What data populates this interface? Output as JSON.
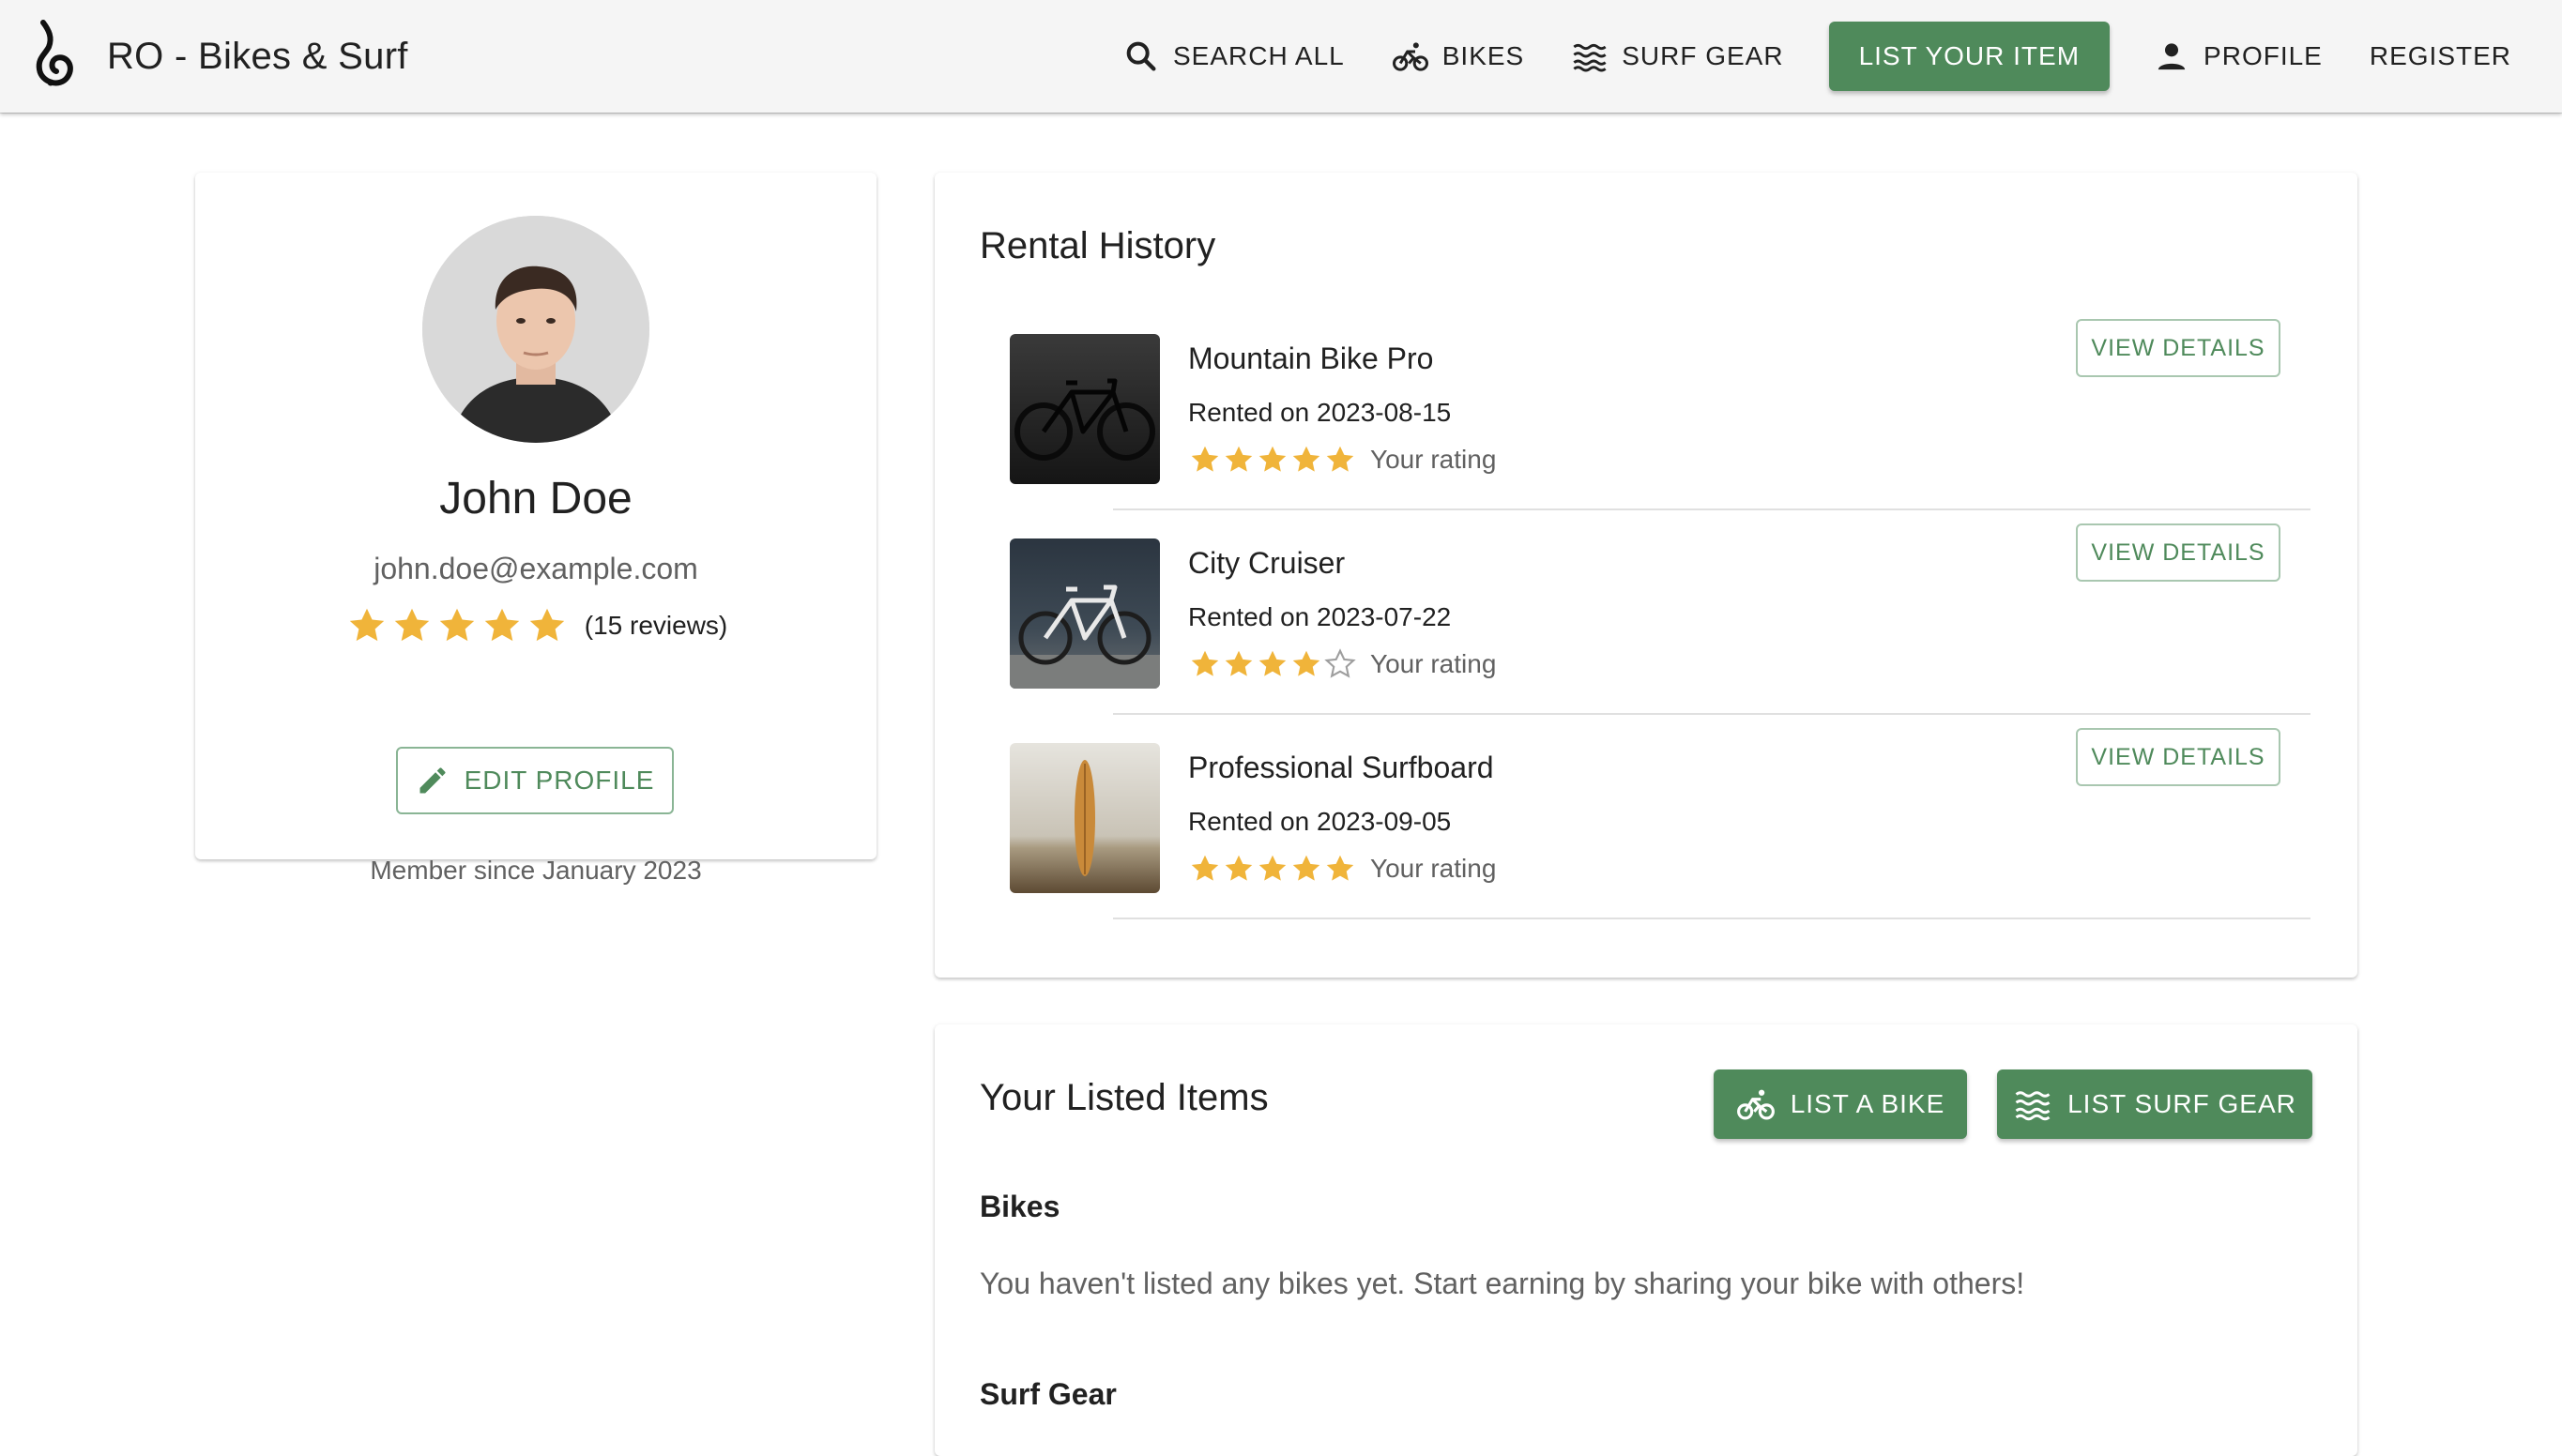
{
  "app": {
    "title": "RO - Bikes & Surf",
    "logo_icon": "logo-hook-icon"
  },
  "nav": {
    "items": [
      {
        "label": "SEARCH ALL",
        "icon": "search-icon"
      },
      {
        "label": "BIKES",
        "icon": "bike-icon"
      },
      {
        "label": "SURF GEAR",
        "icon": "waves-icon"
      },
      {
        "label": "LIST YOUR ITEM",
        "icon": ""
      },
      {
        "label": "PROFILE",
        "icon": "person-icon"
      },
      {
        "label": "REGISTER",
        "icon": ""
      }
    ]
  },
  "profile": {
    "name": "John Doe",
    "email": "john.doe@example.com",
    "rating": 5,
    "reviews": "(15 reviews)",
    "member_since": "Member since January 2023",
    "edit_label": "EDIT PROFILE"
  },
  "rental_history": {
    "title": "Rental History",
    "view_label": "VIEW DETAILS",
    "rating_label": "Your rating",
    "items": [
      {
        "name": "Mountain Bike Pro",
        "date": "Rented on 2023-08-15",
        "rating": 5,
        "thumb": "dark-road-bike"
      },
      {
        "name": "City Cruiser",
        "date": "Rented on 2023-07-22",
        "rating": 4,
        "thumb": "white-city-bike"
      },
      {
        "name": "Professional Surfboard",
        "date": "Rented on 2023-09-05",
        "rating": 5,
        "thumb": "surfboard-beach"
      }
    ]
  },
  "listed": {
    "title": "Your Listed Items",
    "list_bike_label": "LIST A BIKE",
    "list_surf_label": "LIST SURF GEAR",
    "bikes_heading": "Bikes",
    "bikes_empty": "You haven't listed any bikes yet. Start earning by sharing your bike with others!",
    "surf_heading": "Surf Gear"
  },
  "colors": {
    "primary": "#4f8a5b",
    "star": "#f0b43a",
    "appbar": "#f5f5f5"
  }
}
